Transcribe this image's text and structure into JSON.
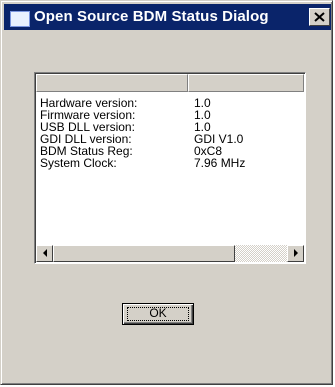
{
  "window": {
    "title": "Open Source BDM Status Dialog"
  },
  "list": {
    "columns": [
      "",
      ""
    ],
    "rows": [
      {
        "label": "Hardware version:",
        "value": "1.0"
      },
      {
        "label": "Firmware version:",
        "value": "1.0"
      },
      {
        "label": "USB DLL version:",
        "value": "1.0"
      },
      {
        "label": "GDI DLL version:",
        "value": "GDI V1.0"
      },
      {
        "label": "BDM Status Reg:",
        "value": "0xC8"
      },
      {
        "label": "System Clock:",
        "value": "7.96 MHz"
      }
    ]
  },
  "buttons": {
    "ok": "OK"
  },
  "icons": {
    "title": "app-window-icon",
    "close": "close-icon",
    "scroll_left": "arrow-left-icon",
    "scroll_right": "arrow-right-icon"
  },
  "colors": {
    "titlebar": "#0a246a",
    "face": "#d4d0c8",
    "title_text": "#ffffff"
  }
}
